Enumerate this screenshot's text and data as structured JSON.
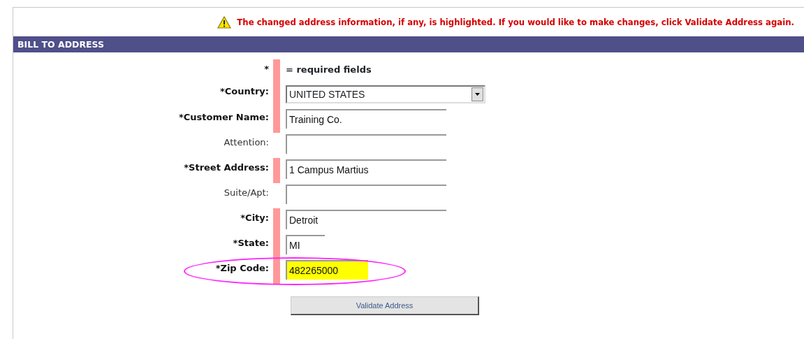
{
  "notice": {
    "text": "The changed address information, if any, is highlighted. If you would like to make changes, click Validate Address again."
  },
  "section": {
    "title": "BILL TO ADDRESS"
  },
  "legend": {
    "mark": "*",
    "text": "= required fields"
  },
  "fields": [
    {
      "label": "*Country:",
      "kind": "select",
      "value": "UNITED STATES",
      "required": true
    },
    {
      "label": "*Customer Name:",
      "kind": "text",
      "value": "Training Co.",
      "required": true
    },
    {
      "label": "Attention:",
      "kind": "text",
      "required": false
    },
    {
      "label": "*Street Address:",
      "kind": "text",
      "value": "1 Campus Martius",
      "required": true
    },
    {
      "label": "Suite/Apt:",
      "kind": "text",
      "required": false
    },
    {
      "label": "*City:",
      "kind": "text",
      "value": "Detroit",
      "required": true
    },
    {
      "label": "*State:",
      "kind": "short",
      "value": "MI",
      "required": true
    },
    {
      "label": "*Zip Code:",
      "kind": "medium",
      "value": "482265000",
      "required": true,
      "highlighted": true,
      "circled": true
    }
  ],
  "button": {
    "label": "Validate Address"
  }
}
